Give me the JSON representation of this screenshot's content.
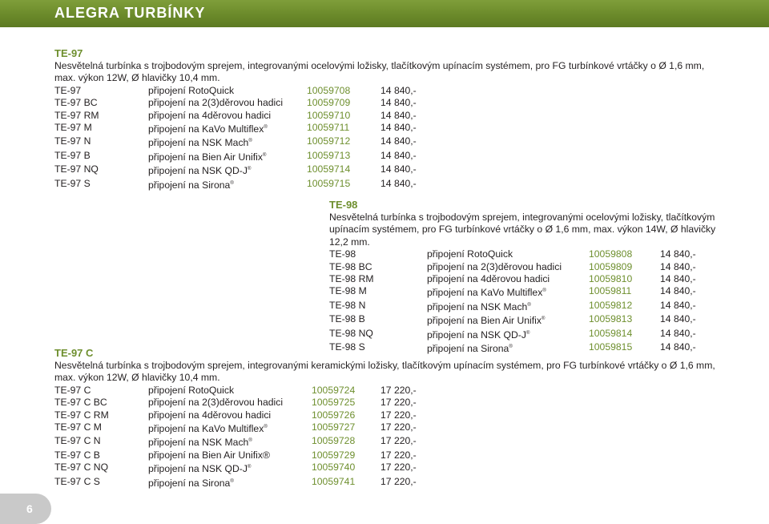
{
  "header": {
    "title": "ALEGRA TURBÍNKY",
    "bar_color": "#6b8a2a"
  },
  "accent_color": "#6e8f2e",
  "sections": {
    "te97": {
      "title": "TE-97",
      "description": "Nesvětelná turbínka s trojbodovým sprejem, integrovanými ocelovými ložisky, tlačítkovým upínacím systémem, pro FG turbínkové vrtáčky o Ø 1,6 mm, max. výkon 12W, Ø hlavičky 10,4 mm.",
      "rows": [
        {
          "model": "TE-97",
          "connection": "připojení RotoQuick",
          "reg": "",
          "code": "10059708",
          "price": "14 840,-"
        },
        {
          "model": "TE-97 BC",
          "connection": "připojení na 2(3)děrovou hadici",
          "reg": "",
          "code": "10059709",
          "price": "14 840,-"
        },
        {
          "model": "TE-97 RM",
          "connection": "připojení na 4děrovou hadici",
          "reg": "",
          "code": "10059710",
          "price": "14 840,-"
        },
        {
          "model": "TE-97 M",
          "connection": "připojení na KaVo Multiflex",
          "reg": "®",
          "code": "10059711",
          "price": "14 840,-"
        },
        {
          "model": "TE-97 N",
          "connection": "připojení na NSK Mach",
          "reg": "®",
          "code": "10059712",
          "price": "14 840,-"
        },
        {
          "model": "TE-97 B",
          "connection": "připojení na Bien Air Unifix",
          "reg": "®",
          "code": "10059713",
          "price": "14 840,-"
        },
        {
          "model": "TE-97 NQ",
          "connection": "připojení na NSK QD-J",
          "reg": "®",
          "code": "10059714",
          "price": "14 840,-"
        },
        {
          "model": "TE-97 S",
          "connection": "připojení na Sirona",
          "reg": "®",
          "code": "10059715",
          "price": "14 840,-"
        }
      ]
    },
    "te98": {
      "title": "TE-98",
      "description": "Nesvětelná turbínka s trojbodovým sprejem, integrovanými ocelovými ložisky, tlačítkovým upínacím systémem, pro FG turbínkové vrtáčky o Ø 1,6 mm, max. výkon 14W, Ø hlavičky 12,2 mm.",
      "rows": [
        {
          "model": "TE-98",
          "connection": "připojení RotoQuick",
          "reg": "",
          "code": "10059808",
          "price": "14 840,-"
        },
        {
          "model": "TE-98 BC",
          "connection": "připojení na 2(3)děrovou hadici",
          "reg": "",
          "code": "10059809",
          "price": "14 840,-"
        },
        {
          "model": "TE-98 RM",
          "connection": "připojení na 4děrovou hadici",
          "reg": "",
          "code": "10059810",
          "price": "14 840,-"
        },
        {
          "model": "TE-98 M",
          "connection": "připojení na KaVo Multiflex",
          "reg": "®",
          "code": "10059811",
          "price": "14 840,-"
        },
        {
          "model": "TE-98 N",
          "connection": "připojení na NSK Mach",
          "reg": "®",
          "code": "10059812",
          "price": "14 840,-"
        },
        {
          "model": "TE-98 B",
          "connection": "připojení na Bien Air Unifix",
          "reg": "®",
          "code": "10059813",
          "price": "14 840,-"
        },
        {
          "model": "TE-98 NQ",
          "connection": "připojení na NSK QD-J",
          "reg": "®",
          "code": "10059814",
          "price": "14 840,-"
        },
        {
          "model": "TE-98 S",
          "connection": "připojení na Sirona",
          "reg": "®",
          "code": "10059815",
          "price": "14 840,-"
        }
      ]
    },
    "te97c": {
      "title": "TE-97 C",
      "description": "Nesvětelná turbínka s trojbodovým sprejem, integrovanými keramickými ložisky, tlačítkovým upínacím systémem, pro FG turbínkové vrtáčky o Ø 1,6 mm, max. výkon 12W, Ø hlavičky 10,4 mm.",
      "rows": [
        {
          "model": "TE-97 C",
          "connection": "připojení RotoQuick",
          "reg": "",
          "code": "10059724",
          "price": "17 220,-"
        },
        {
          "model": "TE-97 C BC",
          "connection": "připojení na 2(3)děrovou hadici",
          "reg": "",
          "code": "10059725",
          "price": "17 220,-"
        },
        {
          "model": "TE-97 C RM",
          "connection": "připojení na 4děrovou hadici",
          "reg": "",
          "code": "10059726",
          "price": "17 220,-"
        },
        {
          "model": "TE-97 C M",
          "connection": "připojení na KaVo Multiflex",
          "reg": "®",
          "code": "10059727",
          "price": "17 220,-"
        },
        {
          "model": "TE-97 C N",
          "connection": "připojení na NSK Mach",
          "reg": "®",
          "code": "10059728",
          "price": "17 220,-"
        },
        {
          "model": "TE-97 C B",
          "connection": "připojení na Bien Air Unifix®",
          "reg": "",
          "code": "10059729",
          "price": "17 220,-"
        },
        {
          "model": "TE-97 C NQ",
          "connection": "připojení na NSK QD-J",
          "reg": "®",
          "code": "10059740",
          "price": "17 220,-"
        },
        {
          "model": "TE-97 C S",
          "connection": "připojení na Sirona",
          "reg": "®",
          "code": "10059741",
          "price": "17 220,-"
        }
      ]
    }
  },
  "page": {
    "number": "6"
  }
}
